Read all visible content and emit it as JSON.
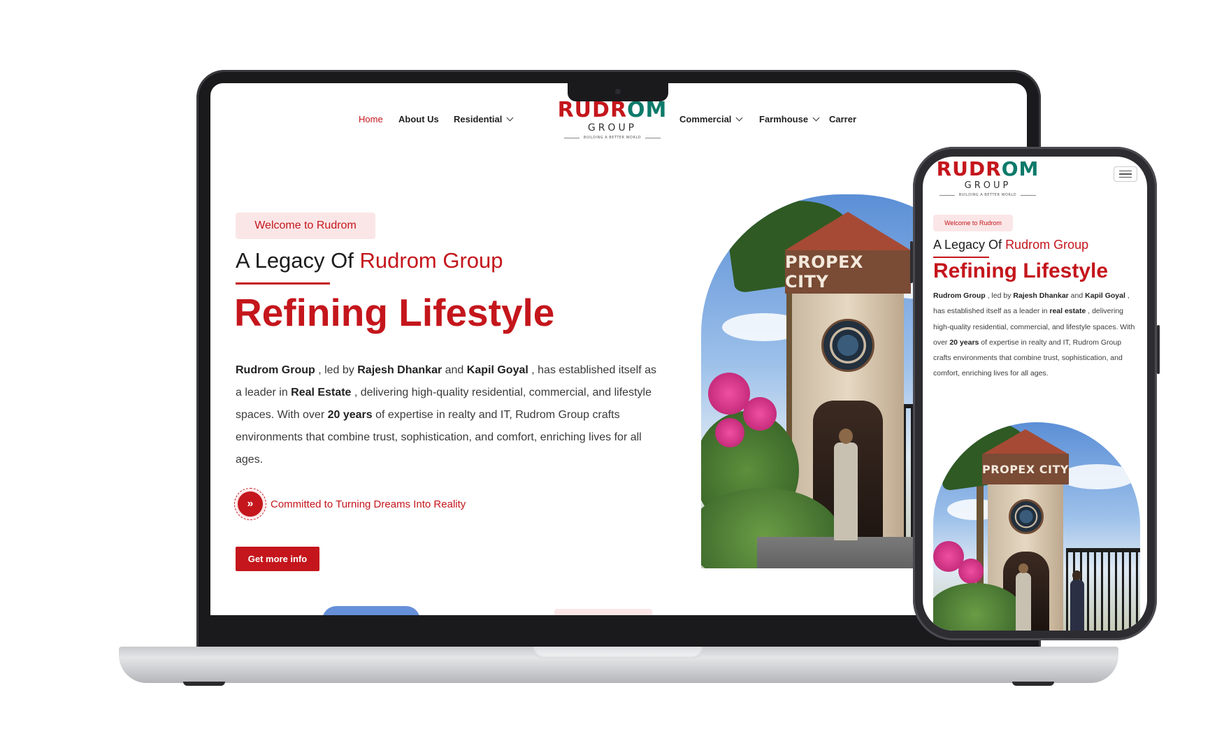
{
  "brand": {
    "logo_part1": "RUDR",
    "logo_part2": "OM",
    "logo_group": "GROUP",
    "logo_tagline": "BUILDING A BETTER WORLD"
  },
  "nav": {
    "left": [
      {
        "label": "Home",
        "active": true
      },
      {
        "label": "About Us",
        "active": false
      },
      {
        "label": "Residential",
        "has_dropdown": true
      }
    ],
    "right": [
      {
        "label": "Commercial",
        "has_dropdown": true
      },
      {
        "label": "Farmhouse",
        "has_dropdown": true
      },
      {
        "label": "Carrer",
        "has_dropdown": false
      }
    ]
  },
  "hero": {
    "welcome_badge": "Welcome to Rudrom",
    "legacy_prefix": "A Legacy Of ",
    "legacy_highlight": "Rudrom Group",
    "headline": "Refining Lifestyle",
    "para_desktop": [
      {
        "t": "Rudrom Group",
        "b": true
      },
      {
        "t": " , led by ",
        "b": false
      },
      {
        "t": "Rajesh Dhankar",
        "b": true
      },
      {
        "t": " and ",
        "b": false
      },
      {
        "t": "Kapil Goyal",
        "b": true
      },
      {
        "t": " , has established itself as a leader in ",
        "b": false
      },
      {
        "t": "Real Estate",
        "b": true
      },
      {
        "t": " , delivering high-quality residential, commercial, and lifestyle spaces. With over ",
        "b": false
      },
      {
        "t": "20 years",
        "b": true
      },
      {
        "t": " of expertise in realty and IT, Rudrom Group crafts environments that combine trust, sophistication, and comfort, enriching lives for all ages.",
        "b": false
      }
    ],
    "para_mobile": [
      {
        "t": "Rudrom Group",
        "b": true
      },
      {
        "t": " , led by ",
        "b": false
      },
      {
        "t": "Rajesh Dhankar",
        "b": true
      },
      {
        "t": " and ",
        "b": false
      },
      {
        "t": "Kapil Goyal",
        "b": true
      },
      {
        "t": " , has established itself as a leader in ",
        "b": false
      },
      {
        "t": "real estate",
        "b": true
      },
      {
        "t": " , delivering high-quality residential, commercial, and lifestyle spaces. With over ",
        "b": false
      },
      {
        "t": "20 years",
        "b": true
      },
      {
        "t": " of expertise in realty and IT, Rudrom Group crafts environments that combine trust, sophistication, and comfort, enriching lives for all ages.",
        "b": false
      }
    ],
    "committed_icon": "»",
    "committed_text": "Committed to Turning Dreams Into Reality",
    "cta_label": "Get more info",
    "image_sign": "PROPEX CITY"
  },
  "colors": {
    "brand_red": "#c4161c",
    "brand_teal": "#0d7a6a",
    "badge_bg": "#fbe6e7"
  },
  "icons": {
    "dropdown": "chevron-down-icon",
    "menu": "hamburger-menu-icon",
    "committed": "double-chevron-right-icon"
  }
}
